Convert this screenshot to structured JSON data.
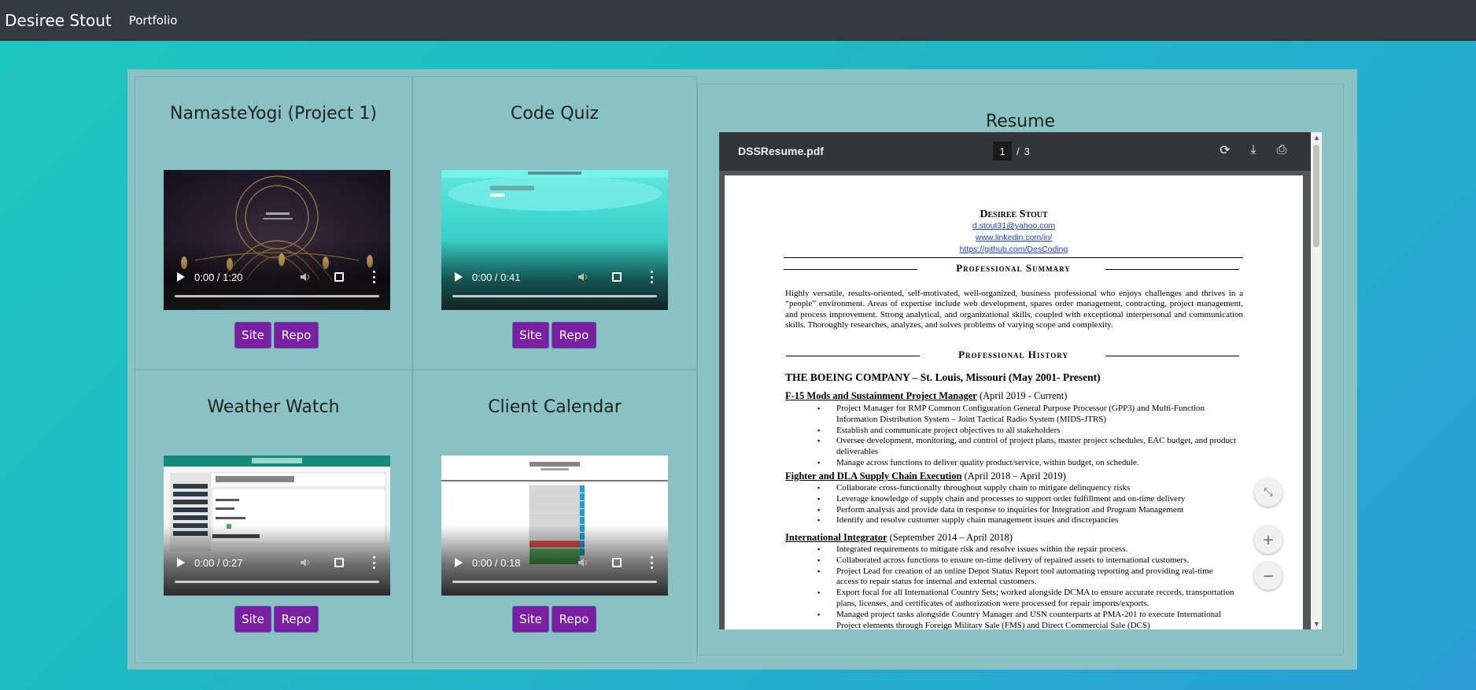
{
  "navbar": {
    "brand": "Desiree Stout",
    "link": "Portfolio"
  },
  "projects": [
    {
      "title": "NamasteYogi (Project 1)",
      "time": "0:00 / 1:20",
      "site": "Site",
      "repo": "Repo"
    },
    {
      "title": "Code Quiz",
      "time": "0:00 / 0:41",
      "site": "Site",
      "repo": "Repo"
    },
    {
      "title": "Weather Watch",
      "time": "0:00 / 0:27",
      "site": "Site",
      "repo": "Repo"
    },
    {
      "title": "Client Calendar",
      "time": "0:00 / 0:18",
      "site": "Site",
      "repo": "Repo"
    }
  ],
  "resume": {
    "heading": "Resume",
    "toolbar": {
      "filename": "DSSResume.pdf",
      "page": "1",
      "sep": "/",
      "total": "3"
    },
    "doc": {
      "name": "Desiree Stout",
      "email": "d.stout31@yahoo.com",
      "linkedin": "www.linkedin.com/in/",
      "github": "https://github.com/DesCoding",
      "summary_heading": "Professional Summary",
      "summary": "Highly versatile, results-oriented, self-motivated, well-organized, business professional who enjoys challenges and thrives in a “people” environment. Areas of expertise include web development, spares order management, contracting, project management, and process improvement. Strong analytical, and organizational skills, coupled with exceptional interpersonal and communication skills. Thoroughly researches, analyzes, and solves problems of varying scope and complexity.",
      "history_heading": "Professional History",
      "company": "THE BOEING COMPANY – St. Louis, Missouri (May 2001- Present)",
      "roles": [
        {
          "title": "F-15 Mods and Sustainment Project Manager",
          "dates": " (April 2019 - Current)",
          "bullets": [
            "Project Manager for RMP Common Configuration General Purpose Processor (GPP3) and Multi-Function Information Distribution System – Joint Tactical Radio System (MIDS-JTRS)",
            "Establish and communicate project objectives to all stakeholders",
            "Oversee development, monitoring, and control of project plans, master project schedules, EAC budget, and product deliverables",
            "Manage across functions to deliver quality product/service, within budget, on schedule."
          ]
        },
        {
          "title": "Fighter and DLA Supply Chain Execution",
          "dates": " (April 2018 – April 2019)",
          "bullets": [
            "Collaborate cross-functionally throughout supply chain to mitigate delinquency risks",
            "Leverage knowledge of supply chain and processes to support order fulfillment and on-time delivery",
            "Perform analysis and provide data in response to inquiries for Integration and Program Management",
            "Identify and resolve customer supply chain management issues and discrepancies"
          ]
        },
        {
          "title": "International Integrator",
          "dates": " (September 2014 – April 2018)",
          "bullets": [
            "Integrated requirements to mitigate risk and resolve issues within the repair process.",
            "Collaborated across functions to ensure on-time delivery of repaired assets to international customers.",
            "Project Lead for creation of an online Depot Status Report tool automating reporting and providing real-time access to repair status for internal and external customers.",
            "Export focal for all International Country Sets; worked alongside DCMA to ensure accurate records, transportation plans, licenses, and certificates of authorization were processed for repair imports/exports.",
            "Managed project tasks alongside Country Manager and USN counterparts at PMA-201 to execute International Project elements through Foreign Military Sale (FMS) and Direct Commercial Sale (DCS)"
          ]
        }
      ]
    }
  }
}
